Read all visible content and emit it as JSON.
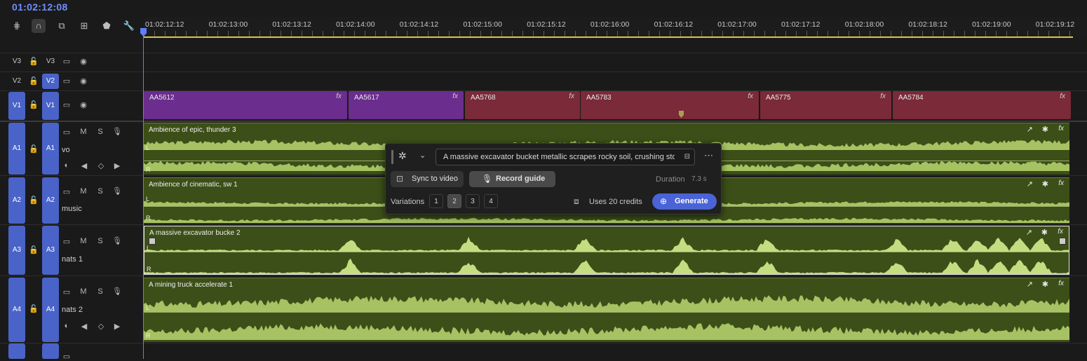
{
  "timecode": "01:02:12:08",
  "toolbar": {
    "icons": [
      "insert-snap-icon",
      "snap-magnet-icon",
      "linked-selection-icon",
      "add-marker-icon",
      "marker-icon",
      "wrench-icon"
    ]
  },
  "ruler": {
    "ticks": [
      "01:02:12:12",
      "01:02:13:00",
      "01:02:13:12",
      "01:02:14:00",
      "01:02:14:12",
      "01:02:15:00",
      "01:02:15:12",
      "01:02:16:00",
      "01:02:16:12",
      "01:02:17:00",
      "01:02:17:12",
      "01:02:18:00",
      "01:02:18:12",
      "01:02:19:00",
      "01:02:19:12"
    ]
  },
  "video_tracks": [
    {
      "source": "V3",
      "target": "V3"
    },
    {
      "source": "V2",
      "target": "V2"
    },
    {
      "source": "V1",
      "target": "V1"
    }
  ],
  "video_clips": [
    {
      "name": "AA5612",
      "fx": "fx",
      "color": "#6b2d8e"
    },
    {
      "name": "AA5617",
      "fx": "fx",
      "color": "#6b2d8e"
    },
    {
      "name": "AA5768",
      "fx": "fx",
      "color": "#7a2a38"
    },
    {
      "name": "AA5783",
      "fx": "fx",
      "color": "#7a2a38"
    },
    {
      "name": "AA5775",
      "fx": "fx",
      "color": "#7a2a38"
    },
    {
      "name": "AA5784",
      "fx": "fx",
      "color": "#7a2a38"
    }
  ],
  "audio_tracks": [
    {
      "source": "A1",
      "target": "A1",
      "name": "vo",
      "m": "M",
      "s": "S"
    },
    {
      "source": "A2",
      "target": "A2",
      "name": "music",
      "m": "M",
      "s": "S"
    },
    {
      "source": "A3",
      "target": "A3",
      "name": "nats 1",
      "m": "M",
      "s": "S"
    },
    {
      "source": "A4",
      "target": "A4",
      "name": "nats 2",
      "m": "M",
      "s": "S"
    }
  ],
  "audio_clips": [
    {
      "name": "Ambience of epic, thunder 3",
      "left": "L",
      "right": "R"
    },
    {
      "name": "Ambience of cinematic, sw 1",
      "left": "L",
      "right": "R"
    },
    {
      "name": "A massive excavator bucke 2",
      "left": "L",
      "right": "R"
    },
    {
      "name": "A mining truck accelerate 1",
      "left": "L",
      "right": "R"
    }
  ],
  "clip_fx": "fx",
  "generator": {
    "prompt": "A massive excavator bucket metallic scrapes rocky soil, crushing stones",
    "sync_label": "Sync to video",
    "record_label": "Record guide",
    "duration_label": "Duration",
    "duration_value": "7.3 s",
    "variations_label": "Variations",
    "variations": [
      "1",
      "2",
      "3",
      "4"
    ],
    "selected_variation": "2",
    "credits_label": "Uses 20 credits",
    "generate_label": "Generate",
    "accent": "#4a63d6"
  }
}
